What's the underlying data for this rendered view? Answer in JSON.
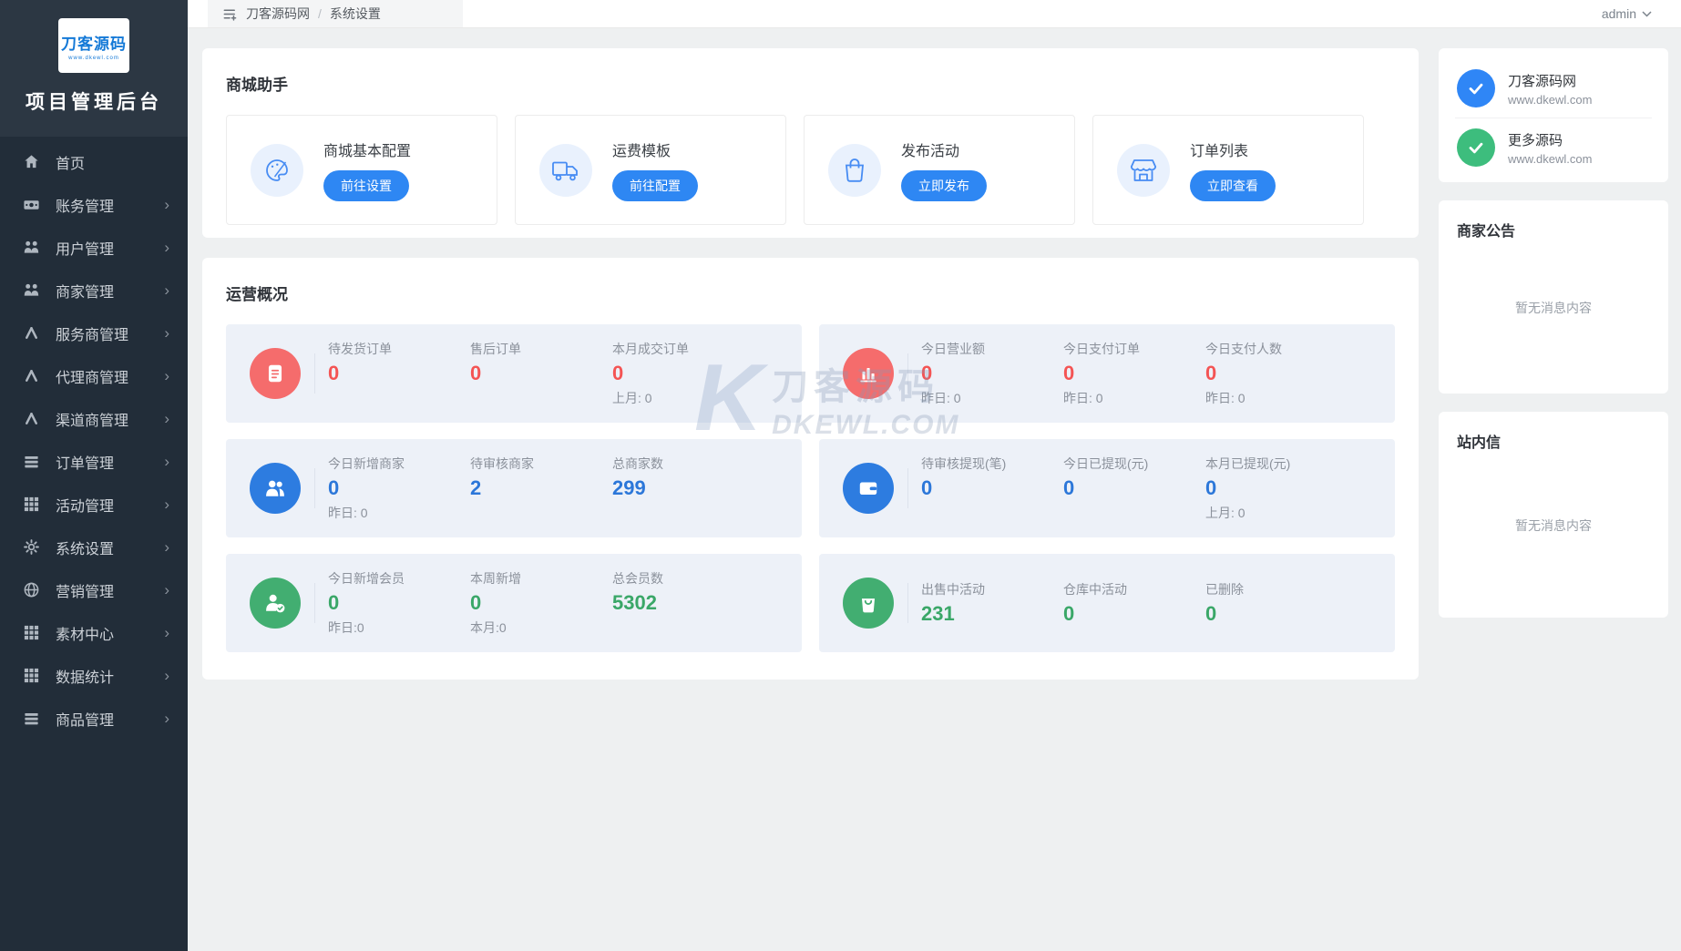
{
  "sidebar": {
    "logo_text": "刀客源码",
    "logo_sub": "www.dkewl.com",
    "title": "项目管理后台",
    "items": [
      {
        "label": "首页",
        "icon": "home-icon",
        "has_children": false
      },
      {
        "label": "账务管理",
        "icon": "banknote-icon",
        "has_children": true
      },
      {
        "label": "用户管理",
        "icon": "users-icon",
        "has_children": true
      },
      {
        "label": "商家管理",
        "icon": "users-icon",
        "has_children": true
      },
      {
        "label": "服务商管理",
        "icon": "person-network-icon",
        "has_children": true
      },
      {
        "label": "代理商管理",
        "icon": "person-network-icon",
        "has_children": true
      },
      {
        "label": "渠道商管理",
        "icon": "person-network-icon",
        "has_children": true
      },
      {
        "label": "订单管理",
        "icon": "list-icon",
        "has_children": true
      },
      {
        "label": "活动管理",
        "icon": "grid-icon",
        "has_children": true
      },
      {
        "label": "系统设置",
        "icon": "gear-icon",
        "has_children": true
      },
      {
        "label": "营销管理",
        "icon": "globe-icon",
        "has_children": true
      },
      {
        "label": "素材中心",
        "icon": "grid-icon",
        "has_children": true
      },
      {
        "label": "数据统计",
        "icon": "grid-icon",
        "has_children": true
      },
      {
        "label": "商品管理",
        "icon": "list-icon",
        "has_children": true
      }
    ]
  },
  "topbar": {
    "breadcrumbs": [
      "刀客源码网",
      "系统设置"
    ],
    "user": "admin"
  },
  "assistant": {
    "title": "商城助手",
    "cards": [
      {
        "label": "商城基本配置",
        "button": "前往设置",
        "icon": "palette-icon"
      },
      {
        "label": "运费模板",
        "button": "前往配置",
        "icon": "truck-icon"
      },
      {
        "label": "发布活动",
        "button": "立即发布",
        "icon": "bag-icon"
      },
      {
        "label": "订单列表",
        "button": "立即查看",
        "icon": "store-icon"
      }
    ]
  },
  "overview": {
    "title": "运营概况",
    "panels": [
      {
        "theme": "red",
        "icon": "document-icon",
        "stats": [
          {
            "label": "待发货订单",
            "value": "0",
            "sub": ""
          },
          {
            "label": "售后订单",
            "value": "0",
            "sub": ""
          },
          {
            "label": "本月成交订单",
            "value": "0",
            "sub": "上月: 0"
          }
        ]
      },
      {
        "theme": "red",
        "icon": "bar-chart-icon",
        "stats": [
          {
            "label": "今日营业额",
            "value": "0",
            "sub": "昨日: 0"
          },
          {
            "label": "今日支付订单",
            "value": "0",
            "sub": "昨日: 0"
          },
          {
            "label": "今日支付人数",
            "value": "0",
            "sub": "昨日: 0"
          }
        ]
      },
      {
        "theme": "blue",
        "icon": "users-icon",
        "stats": [
          {
            "label": "今日新增商家",
            "value": "0",
            "sub": "昨日: 0"
          },
          {
            "label": "待审核商家",
            "value": "2",
            "sub": ""
          },
          {
            "label": "总商家数",
            "value": "299",
            "sub": ""
          }
        ]
      },
      {
        "theme": "blue",
        "icon": "wallet-icon",
        "stats": [
          {
            "label": "待审核提现(笔)",
            "value": "0",
            "sub": ""
          },
          {
            "label": "今日已提现(元)",
            "value": "0",
            "sub": ""
          },
          {
            "label": "本月已提现(元)",
            "value": "0",
            "sub": "上月: 0"
          }
        ]
      },
      {
        "theme": "green",
        "icon": "member-check-icon",
        "stats": [
          {
            "label": "今日新增会员",
            "value": "0",
            "sub": "昨日:0"
          },
          {
            "label": "本周新增",
            "value": "0",
            "sub": "本月:0"
          },
          {
            "label": "总会员数",
            "value": "5302",
            "sub": ""
          }
        ]
      },
      {
        "theme": "green",
        "icon": "shopping-bag-icon",
        "stats": [
          {
            "label": "出售中活动",
            "value": "231",
            "sub": ""
          },
          {
            "label": "仓库中活动",
            "value": "0",
            "sub": ""
          },
          {
            "label": "已删除",
            "value": "0",
            "sub": ""
          }
        ]
      }
    ]
  },
  "rightbar": {
    "links": [
      {
        "title": "刀客源码网",
        "url": "www.dkewl.com",
        "color": "#2f86f6"
      },
      {
        "title": "更多源码",
        "url": "www.dkewl.com",
        "color": "#3dbd7d"
      }
    ],
    "notice": {
      "title": "商家公告",
      "empty": "暂无消息内容"
    },
    "mail": {
      "title": "站内信",
      "empty": "暂无消息内容"
    }
  },
  "watermark": {
    "k": "K",
    "line1": "刀客源码",
    "line2": "DKEWL.COM"
  },
  "colors": {
    "accent_blue": "#2e87f3",
    "stat_red": "#f56c6c",
    "stat_blue": "#2d7ce0",
    "stat_green": "#42ae71",
    "sidebar_bg": "#222d39",
    "panel_bg": "#edf1f8"
  }
}
